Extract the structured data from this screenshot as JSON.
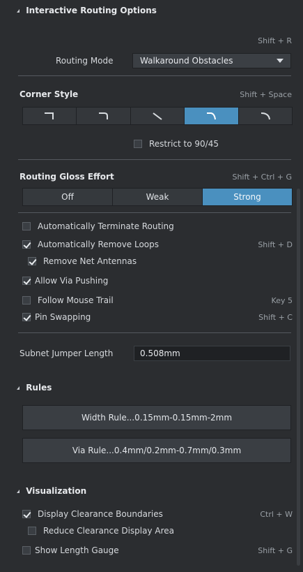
{
  "interactive_routing": {
    "header": "Interactive Routing Options",
    "routing_mode": {
      "shortcut": "Shift + R",
      "label": "Routing Mode",
      "value": "Walkaround Obstacles"
    },
    "corner_style": {
      "title": "Corner Style",
      "shortcut": "Shift + Space",
      "selected_index": 3,
      "restrict_label": "Restrict to 90/45"
    },
    "gloss": {
      "title": "Routing Gloss Effort",
      "shortcut": "Shift + Ctrl + G",
      "options": [
        "Off",
        "Weak",
        "Strong"
      ],
      "selected": "Strong"
    },
    "options": [
      {
        "label": "Automatically Terminate Routing",
        "checked": false,
        "shortcut": ""
      },
      {
        "label": "Automatically Remove Loops",
        "checked": true,
        "shortcut": "Shift + D"
      },
      {
        "label": "Remove Net Antennas",
        "checked": true,
        "shortcut": ""
      },
      {
        "label": "Allow Via Pushing",
        "checked": true,
        "shortcut": ""
      },
      {
        "label": "Follow Mouse Trail",
        "checked": false,
        "shortcut": "Key 5"
      },
      {
        "label": "Pin Swapping",
        "checked": true,
        "shortcut": "Shift + C"
      }
    ],
    "subnet": {
      "label": "Subnet Jumper Length",
      "value": "0.508mm"
    }
  },
  "rules": {
    "header": "Rules",
    "width_rule": "Width Rule...0.15mm-0.15mm-2mm",
    "via_rule": "Via Rule...0.4mm/0.2mm-0.7mm/0.3mm"
  },
  "visualization": {
    "header": "Visualization",
    "items": [
      {
        "label": "Display Clearance Boundaries",
        "checked": true,
        "shortcut": "Ctrl + W"
      },
      {
        "label": "Reduce Clearance Display Area",
        "checked": false,
        "shortcut": ""
      },
      {
        "label": "Show Length Gauge",
        "checked": false,
        "shortcut": "Shift + G"
      }
    ]
  },
  "colors": {
    "accent": "#4a90bf",
    "background": "#2b2d30"
  }
}
